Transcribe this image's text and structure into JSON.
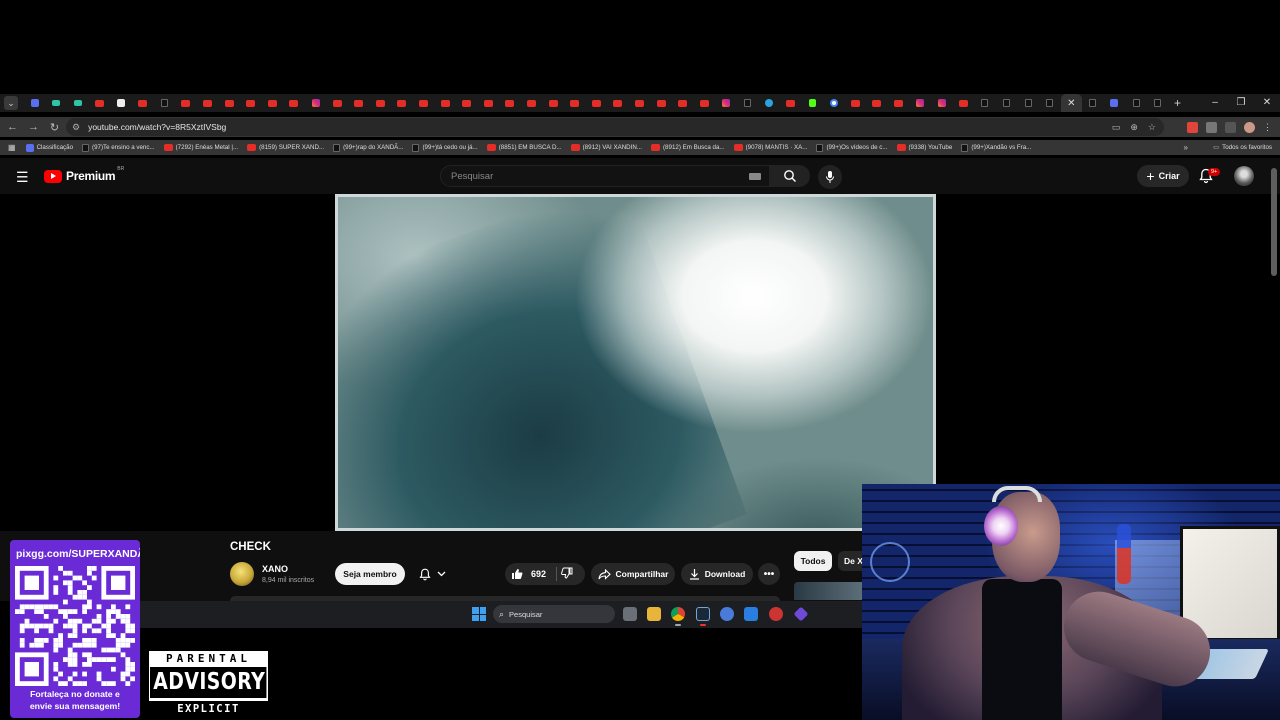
{
  "browser": {
    "url": "youtube.com/watch?v=8R5XztIVSbg",
    "bookmarks": [
      {
        "label": "Classificação",
        "icon": "bl"
      },
      {
        "label": "(97)Te ensino a venc...",
        "icon": "tt"
      },
      {
        "label": "(7292) Enéas Metal |...",
        "icon": "yt"
      },
      {
        "label": "(8159) SUPER XAND...",
        "icon": "yt"
      },
      {
        "label": "(99+)rap do XANDÃ...",
        "icon": "tt"
      },
      {
        "label": "(99+)tá cedo ou já...",
        "icon": "tt"
      },
      {
        "label": "(8851) EM BUSCA D...",
        "icon": "yt"
      },
      {
        "label": "(8912) VAI XANDIN...",
        "icon": "yt"
      },
      {
        "label": "(8912) Em Busca da...",
        "icon": "yt"
      },
      {
        "label": "(9078) MANTIS · XA...",
        "icon": "yt"
      },
      {
        "label": "(99+)Os vídeos de c...",
        "icon": "tt"
      },
      {
        "label": "(9338) YouTube",
        "icon": "yt"
      },
      {
        "label": "(99+)Xandão vs Fra...",
        "icon": "tt"
      }
    ],
    "all_bookmarks_label": "Todos os favoritos"
  },
  "youtube": {
    "logo_text": "Premium",
    "country_code": "BR",
    "search_placeholder": "Pesquisar",
    "create_label": "Criar",
    "notification_badge": "9+"
  },
  "video": {
    "title": "CHECK",
    "channel": "XANO",
    "subscribers": "8,94 mil inscritos",
    "member_label": "Seja membro",
    "likes": "692",
    "share_label": "Compartilhar",
    "download_label": "Download",
    "chips": [
      "Todos",
      "De X"
    ]
  },
  "taskbar": {
    "search_placeholder": "Pesquisar"
  },
  "overlay": {
    "donate_url": "pixgg.com/SUPERXANDÃ",
    "donate_message_line1": "Fortaleça no donate e",
    "donate_message_line2": "envie sua mensagem!",
    "advisory_top": "PARENTAL",
    "advisory_mid": "ADVISORY",
    "advisory_bottom": "EXPLICIT CONTENT"
  }
}
